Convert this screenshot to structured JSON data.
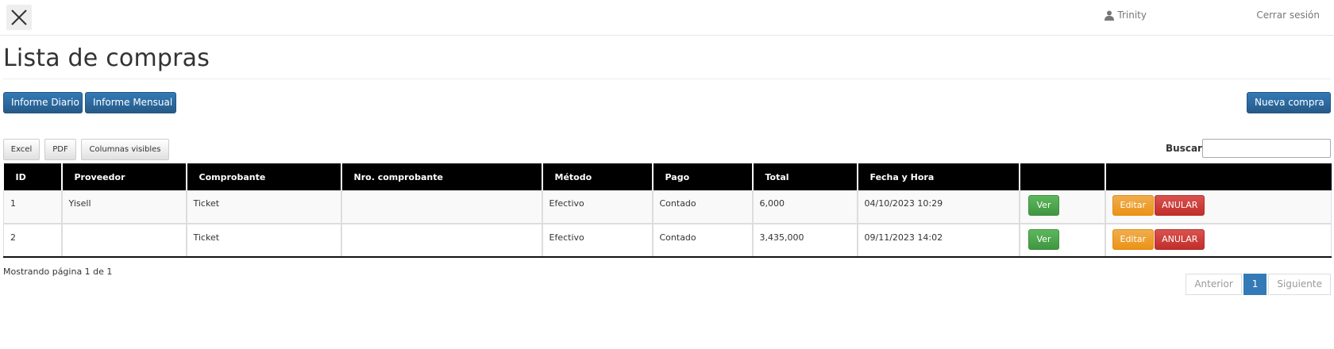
{
  "header": {
    "close_icon": "close-icon",
    "user_icon": "user-icon",
    "user_name": "Trinity",
    "logout_label": "Cerrar sesión"
  },
  "page": {
    "title": "Lista de compras"
  },
  "actions": {
    "daily_report_label": "Informe Diario",
    "monthly_report_label": "Informe Mensual",
    "new_purchase_label": "Nueva compra"
  },
  "export": {
    "excel_label": "Excel",
    "pdf_label": "PDF",
    "columns_label": "Columnas visibles"
  },
  "search": {
    "label": "Buscar",
    "value": "",
    "placeholder": ""
  },
  "table": {
    "headers": [
      "ID",
      "Proveedor",
      "Comprobante",
      "Nro. comprobante",
      "Método",
      "Pago",
      "Total",
      "Fecha y Hora",
      "",
      ""
    ],
    "rows": [
      {
        "id": "1",
        "proveedor": "Yisell",
        "comprobante": "Ticket",
        "nro": "",
        "metodo": "Efectivo",
        "pago": "Contado",
        "total": "6,000",
        "fecha": "04/10/2023 10:29",
        "ver": "Ver",
        "editar": "Editar",
        "anular": "ANULAR"
      },
      {
        "id": "2",
        "proveedor": "",
        "comprobante": "Ticket",
        "nro": "",
        "metodo": "Efectivo",
        "pago": "Contado",
        "total": "3,435,000",
        "fecha": "09/11/2023 14:02",
        "ver": "Ver",
        "editar": "Editar",
        "anular": "ANULAR"
      }
    ]
  },
  "footer": {
    "info": "Mostrando página 1 de 1",
    "prev_label": "Anterior",
    "current_page": "1",
    "next_label": "Siguiente"
  },
  "colors": {
    "primary": "#337ab7",
    "success": "#5cb85c",
    "warning": "#f0ad4e",
    "danger": "#d9534f",
    "table_header": "#000000"
  }
}
